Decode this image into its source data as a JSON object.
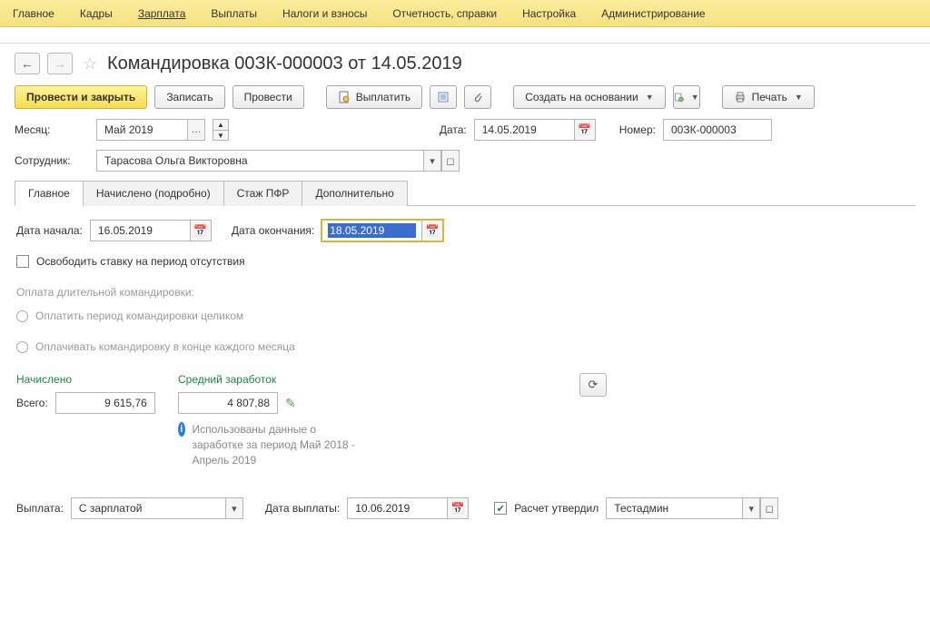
{
  "menu": {
    "items": [
      "Главное",
      "Кадры",
      "Зарплата",
      "Выплаты",
      "Налоги и взносы",
      "Отчетность, справки",
      "Настройка",
      "Администрирование"
    ],
    "active_index": 2
  },
  "title": "Командировка 00ЗК-000003 от 14.05.2019",
  "toolbar": {
    "post_and_close": "Провести и закрыть",
    "save": "Записать",
    "post": "Провести",
    "pay": "Выплатить",
    "create_based": "Создать на основании",
    "print": "Печать"
  },
  "form": {
    "month_label": "Месяц:",
    "month_value": "Май 2019",
    "date_label": "Дата:",
    "date_value": "14.05.2019",
    "number_label": "Номер:",
    "number_value": "00ЗК-000003",
    "employee_label": "Сотрудник:",
    "employee_value": "Тарасова Ольга Викторовна"
  },
  "tabs": [
    "Главное",
    "Начислено (подробно)",
    "Стаж ПФР",
    "Дополнительно"
  ],
  "main_tab": {
    "start_label": "Дата начала:",
    "start_value": "16.05.2019",
    "end_label": "Дата окончания:",
    "end_value": "18.05.2019",
    "release_rate": "Освободить ставку на период отсутствия",
    "long_trip_header": "Оплата длительной командировки:",
    "opt_whole": "Оплатить период командировки целиком",
    "opt_monthly": "Оплачивать командировку в конце каждого месяца",
    "accrued_header": "Начислено",
    "avg_header": "Средний заработок",
    "total_label": "Всего:",
    "total_value": "9 615,76",
    "avg_value": "4 807,88",
    "info_text": "Использованы данные о заработке за период Май 2018 - Апрель 2019"
  },
  "footer": {
    "payout_label": "Выплата:",
    "payout_value": "С зарплатой",
    "paydate_label": "Дата выплаты:",
    "paydate_value": "10.06.2019",
    "approved_label": "Расчет утвердил",
    "approver": "Тестадмин"
  }
}
